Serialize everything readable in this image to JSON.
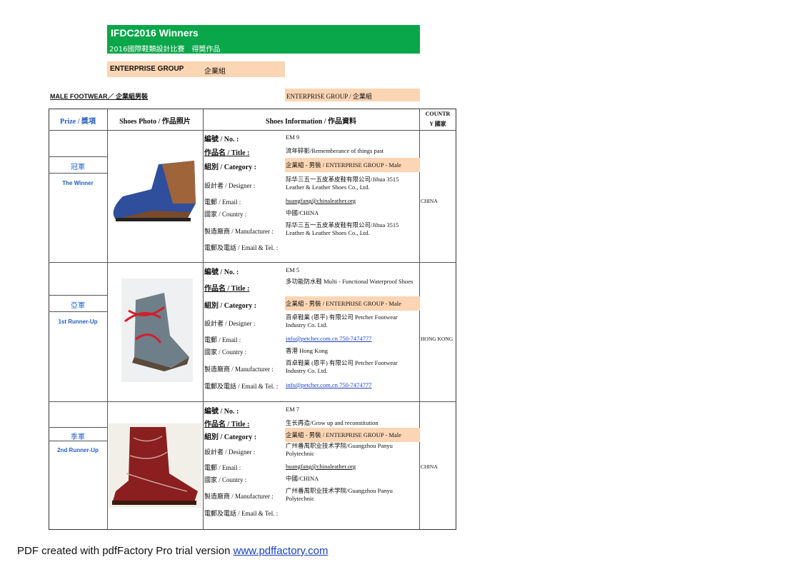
{
  "banner": {
    "title": "IFDC2016  Winners",
    "subtitle": "2016國際鞋類設計比賽　得獎作品"
  },
  "group": {
    "en": "ENTERPRISE GROUP",
    "zh": "企業組"
  },
  "section": {
    "male": "MALE FOOTWEAR／ 企業組男裝",
    "enterprise": "ENTERPRISE GROUP / 企業組"
  },
  "headers": {
    "prize": "Prize / 獎項",
    "photo": "Shoes Photo / 作品照片",
    "info": "Shoes Information / 作品資料",
    "country_a": "COUNTR",
    "country_b": "Y 國家"
  },
  "labels": {
    "no": "編號 / No. :",
    "title": "作品名 / Title :",
    "category": "組別 / Category :",
    "designer": "設計者 / Designer :",
    "email": "電郵 / Email :",
    "country": "國家 / Country :",
    "manufacturer": "製造廠商 / Manufacturer :",
    "email_tel": "電郵及電話 / Email & Tel. :"
  },
  "entries": [
    {
      "prize_zh": "冠軍",
      "prize_en": "The Winner",
      "no": "EM 9",
      "title": "流年碎影/Rememberance of things past",
      "category": "企業組 - 男裝 / ENTERPRISE GROUP - Male",
      "designer": "际华三五一五皮革皮鞋有限公司/Jihua 3515 Leather & Leather Shoes Co., Ltd.",
      "email": "huangfang@chinaleather.org",
      "country": "中國/CHINA",
      "manufacturer": "际华三五一五皮革皮鞋有限公司/Jihua 3515 Leather & Leather Shoes Co., Ltd.",
      "email_tel": "",
      "country_col": "CHINA",
      "shoe_color": "#2f4f9c",
      "shoe_icon": "blue-brown-boot"
    },
    {
      "prize_zh": "亞軍",
      "prize_en": "1st Runner-Up",
      "no": "EM 5",
      "title": "多功能防水鞋  Multi - Functional Waterproof Shoes",
      "category": "企業組 - 男裝 / ENTERPRISE GROUP - Male",
      "designer": "百卓鞋業 (恩平) 有限公司  Petcher Footwear Industry Co. Ltd.",
      "email": "info@petcher.com.cn  750-7474777",
      "country": "香港  Hong Kong",
      "manufacturer": "百卓鞋業 (恩平) 有限公司  Petcher Footwear Industry Co. Ltd.",
      "email_tel": "info@petcher.com.cn  750-7474777",
      "country_col": "HONG KONG",
      "shoe_color": "#6f7f8a",
      "shoe_icon": "gray-red-lace-boot"
    },
    {
      "prize_zh": "季軍",
      "prize_en": "2nd Runner-Up",
      "no": "EM 7",
      "title": "生长再造/Grow up and reconstitution",
      "category": "企業組 - 男裝 / ENTERPRISE GROUP - Male",
      "designer": "广州番禺职业技术学院/Guangzhou Panyu Polytechnic",
      "email": "huangfang@chinaleather.org",
      "country": "中國/CHINA",
      "manufacturer": "广州番禺职业技术学院/Guangzhou Panyu Polytechnic",
      "email_tel": "",
      "country_col": "CHINA",
      "shoe_color": "#8b1e1e",
      "shoe_icon": "red-leather-boot"
    }
  ],
  "footer": {
    "text": "PDF created with pdfFactory Pro trial version ",
    "link": "www.pdffactory.com"
  }
}
